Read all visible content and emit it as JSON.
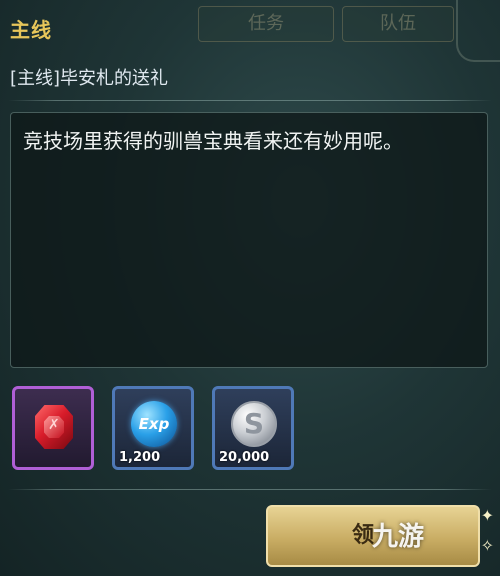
{
  "panel": {
    "title": "主线",
    "quest_name": "[主线]毕安札的送礼",
    "description": "竞技场里获得的驯兽宝典看来还有妙用呢。"
  },
  "rewards": [
    {
      "icon": "red-gem-icon",
      "amount": ""
    },
    {
      "icon": "exp-icon",
      "label": "Exp",
      "amount": "1,200"
    },
    {
      "icon": "silver-coin-icon",
      "label": "S",
      "amount": "20,000"
    }
  ],
  "claim_button": {
    "label": "领"
  },
  "background_tabs": [
    "任务",
    "队伍"
  ],
  "watermark": "九游",
  "colors": {
    "title": "#e7c65a",
    "rare_border": "#b05fd6",
    "common_border": "#4f79b7",
    "button_gold": "#c9ad64"
  }
}
